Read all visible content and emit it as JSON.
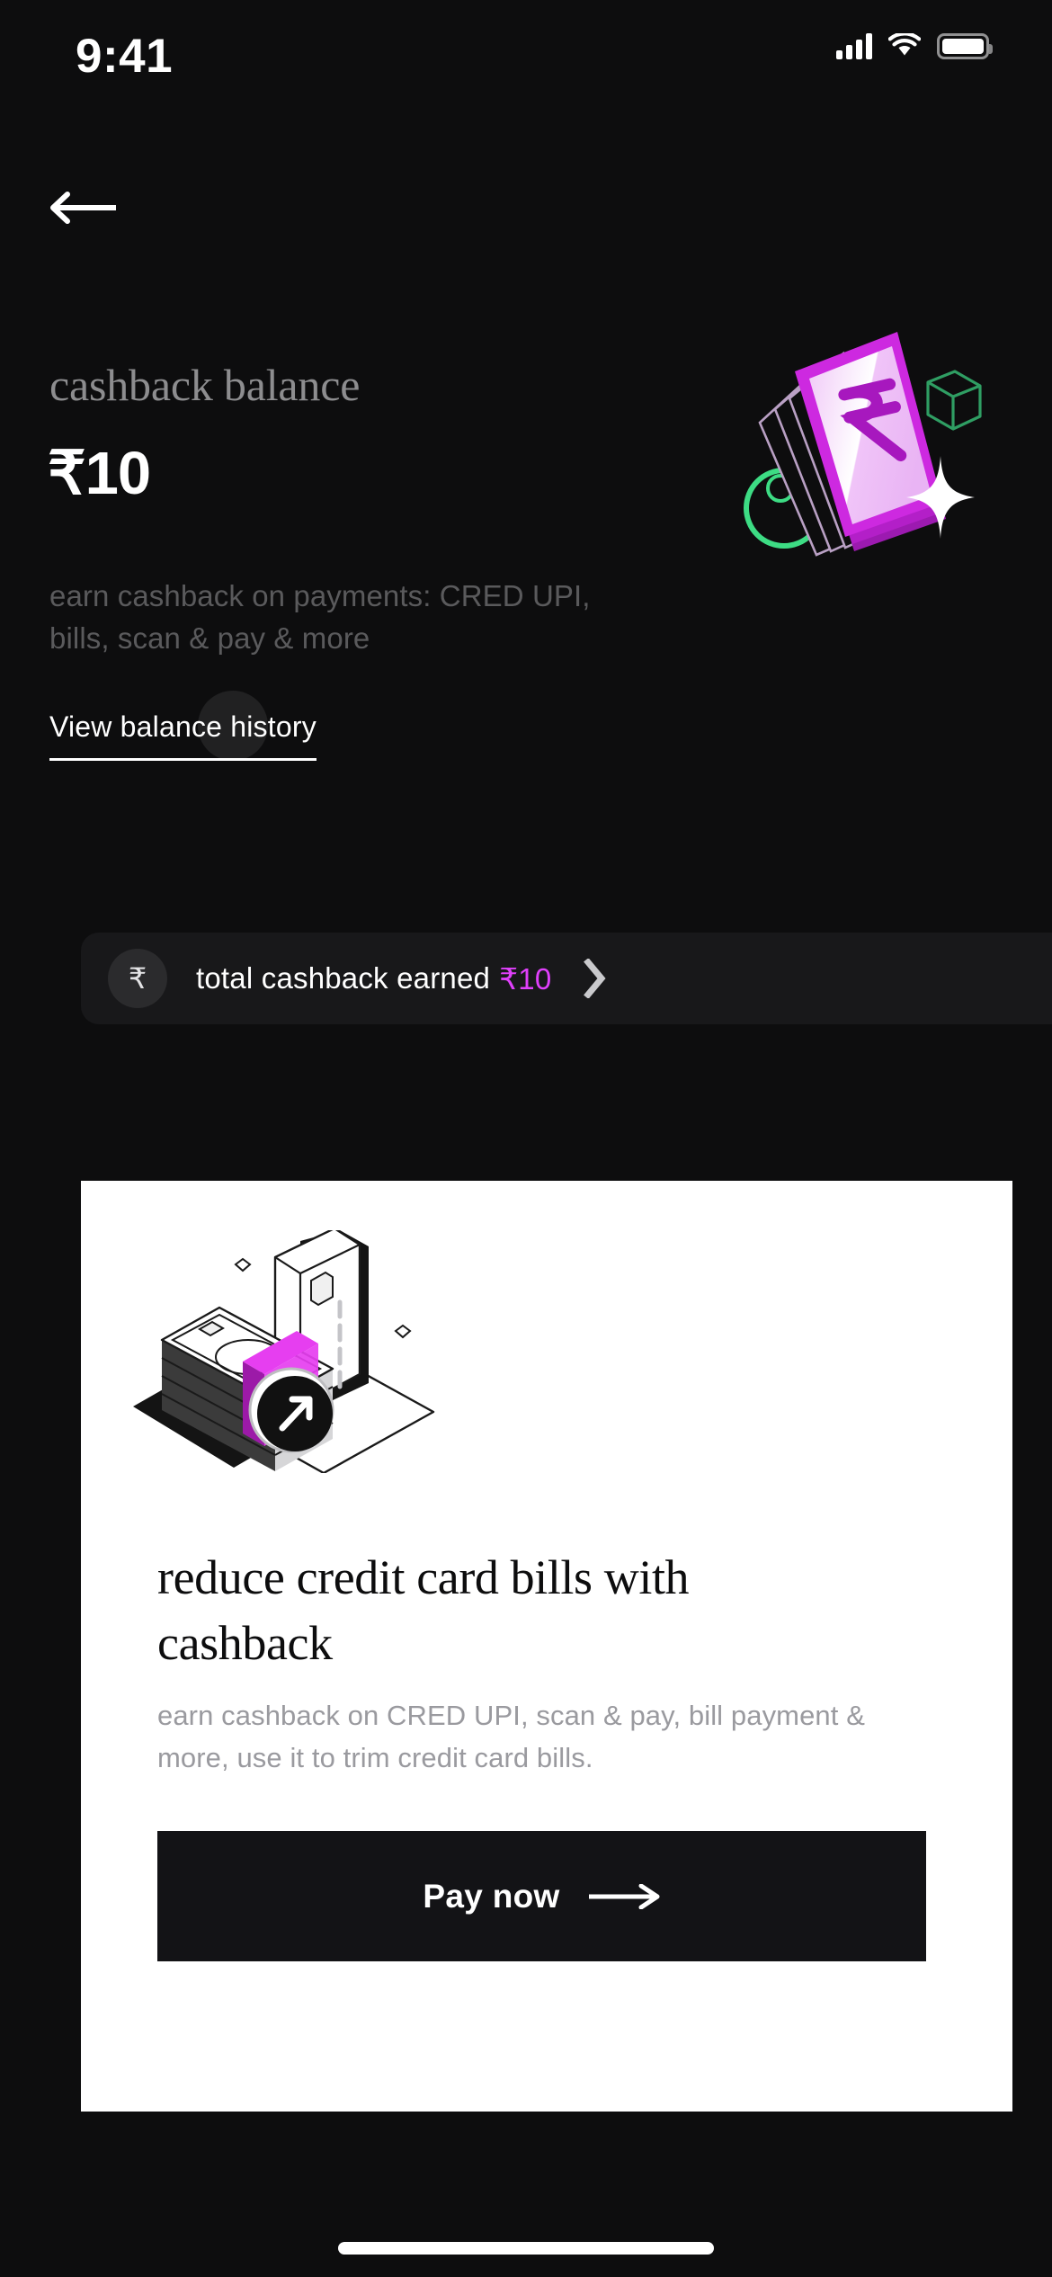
{
  "status_bar": {
    "time": "9:41",
    "signal_icon": "cellular-signal-icon",
    "wifi_icon": "wifi-icon",
    "battery_icon": "battery-icon"
  },
  "nav": {
    "back_icon": "back-arrow-icon"
  },
  "hero": {
    "title": "cashback balance",
    "amount": "₹10",
    "subtitle": "earn cashback on payments: CRED UPI, bills, scan & pay & more",
    "history_link": "View balance history",
    "illustration_icon": "rupee-notes-stack-illustration"
  },
  "earned_row": {
    "icon": "₹",
    "icon_name": "rupee-circle-icon",
    "label": "total cashback earned",
    "amount": "₹10",
    "amount_color": "#E040FB",
    "chevron_icon": "chevron-right-icon"
  },
  "promo_card": {
    "illustration_icon": "cash-and-credit-card-isometric-illustration",
    "title": "reduce credit card bills with cashback",
    "body": "earn cashback on CRED UPI, scan & pay, bill payment & more, use it to trim credit card bills.",
    "button_label": "Pay now",
    "button_arrow_icon": "arrow-right-icon"
  },
  "home_indicator": {
    "name": "home-indicator"
  },
  "colors": {
    "background": "#0D0D0E",
    "panel": "#18181A",
    "card": "#FFFFFF",
    "accent_magenta": "#E040FB",
    "accent_green": "#3DDC84",
    "muted_text": "#5A5A5C"
  }
}
